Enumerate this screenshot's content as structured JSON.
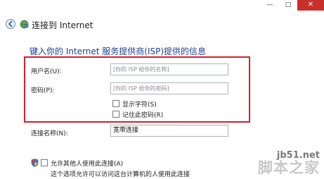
{
  "window": {
    "title": "连接到 Internet",
    "controls": {
      "minimize": "—",
      "maximize": "□",
      "close": "✕"
    }
  },
  "heading": "键入你的 Internet 服务提供商(ISP)提供的信息",
  "form": {
    "username": {
      "label": "用户名(U):",
      "placeholder": "[你的 ISP 给你的名称]",
      "value": ""
    },
    "password": {
      "label": "密码(P):",
      "placeholder": "[你的 ISP 给你的密码]",
      "value": ""
    },
    "show_chars": {
      "label": "显示字符(S)",
      "checked": false
    },
    "remember_password": {
      "label": "记住此密码(R)",
      "checked": false
    },
    "connection_name": {
      "label": "连接名称(N):",
      "value": "宽带连接"
    }
  },
  "allow_others": {
    "label": "允许其他人使用此连接(A)",
    "checked": false,
    "note": "这个选项允许可以访问这台计算机的人使用此连接"
  },
  "watermark": {
    "site": "jb51.net",
    "brand": "脚本之家"
  },
  "colors": {
    "heading": "#1c3f94",
    "highlight_frame": "#d61e2b",
    "close_button": "#c7312a"
  }
}
